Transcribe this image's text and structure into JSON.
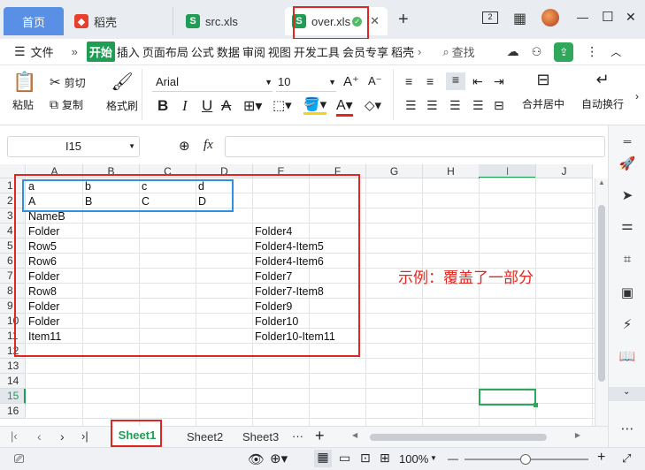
{
  "tabs": {
    "home": "首页",
    "daoke": "稻壳",
    "src": "src.xls",
    "over": "over.xls",
    "new_tab": "+",
    "win_min": "—",
    "win_max": "☐",
    "win_close": "✕"
  },
  "menu": {
    "file": "文件",
    "more": "»",
    "items": [
      "开始",
      "插入",
      "页面布局",
      "公式",
      "数据",
      "审阅",
      "视图",
      "开发工具",
      "会员专享",
      "稻壳"
    ],
    "search": "查找"
  },
  "ribbon": {
    "paste": "粘贴",
    "cut": "剪切",
    "copy": "复制",
    "format_painter": "格式刷",
    "font_name": "Arial",
    "font_size": "10",
    "bold": "B",
    "italic": "I",
    "underline": "U",
    "merge": "合并居中",
    "wrap": "自动换行"
  },
  "formula": {
    "cell_ref": "I15",
    "fx": "fx"
  },
  "columns": [
    "A",
    "B",
    "C",
    "D",
    "E",
    "F",
    "G",
    "H",
    "I",
    "J"
  ],
  "rows": [
    "1",
    "2",
    "3",
    "4",
    "5",
    "6",
    "7",
    "8",
    "9",
    "10",
    "11",
    "12",
    "13",
    "14",
    "15",
    "16"
  ],
  "cells": {
    "r1": [
      "a",
      "b",
      "c",
      "d"
    ],
    "r2": [
      "A",
      "B",
      "C",
      "D"
    ],
    "r3a": "NameB",
    "colA": [
      "Folder",
      "Row5",
      "Row6",
      "Folder",
      "Row8",
      "Folder",
      "Folder",
      "Item11"
    ],
    "colE": [
      "Folder4",
      "Folder4-Item5",
      "Folder4-Item6",
      "Folder7",
      "Folder7-Item8",
      "Folder9",
      "Folder10",
      "Folder10-Item11"
    ]
  },
  "annotation": "示例：覆盖了一部分",
  "sheets": [
    "Sheet1",
    "Sheet2",
    "Sheet3"
  ],
  "sheet_more": "···",
  "sheet_add": "+",
  "status": {
    "zoom": "100%",
    "minus": "—",
    "plus": "+"
  },
  "colors": {
    "accent_green": "#1f9d55",
    "red_box": "#e0261e",
    "blue_box": "#2f8fe0",
    "annotation_red": "#e0261e",
    "home_tab": "#5a8fe6"
  }
}
